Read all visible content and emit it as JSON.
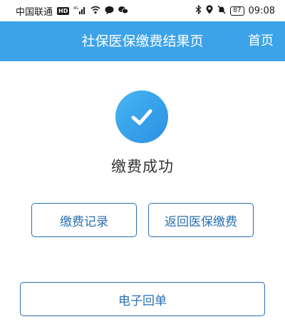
{
  "status_bar": {
    "carrier": "中国联通",
    "hd": "HD",
    "network": "4G",
    "battery": "87",
    "time": "09:08"
  },
  "header": {
    "title": "社保医保缴费结果页",
    "home_label": "首页"
  },
  "result": {
    "message": "缴费成功"
  },
  "buttons": {
    "records": "缴费记录",
    "return": "返回医保缴费",
    "receipt": "电子回单"
  },
  "colors": {
    "header_bg": "#3da3e8",
    "accent": "#2a6fb0",
    "success_circle": "#2b8fe3"
  }
}
